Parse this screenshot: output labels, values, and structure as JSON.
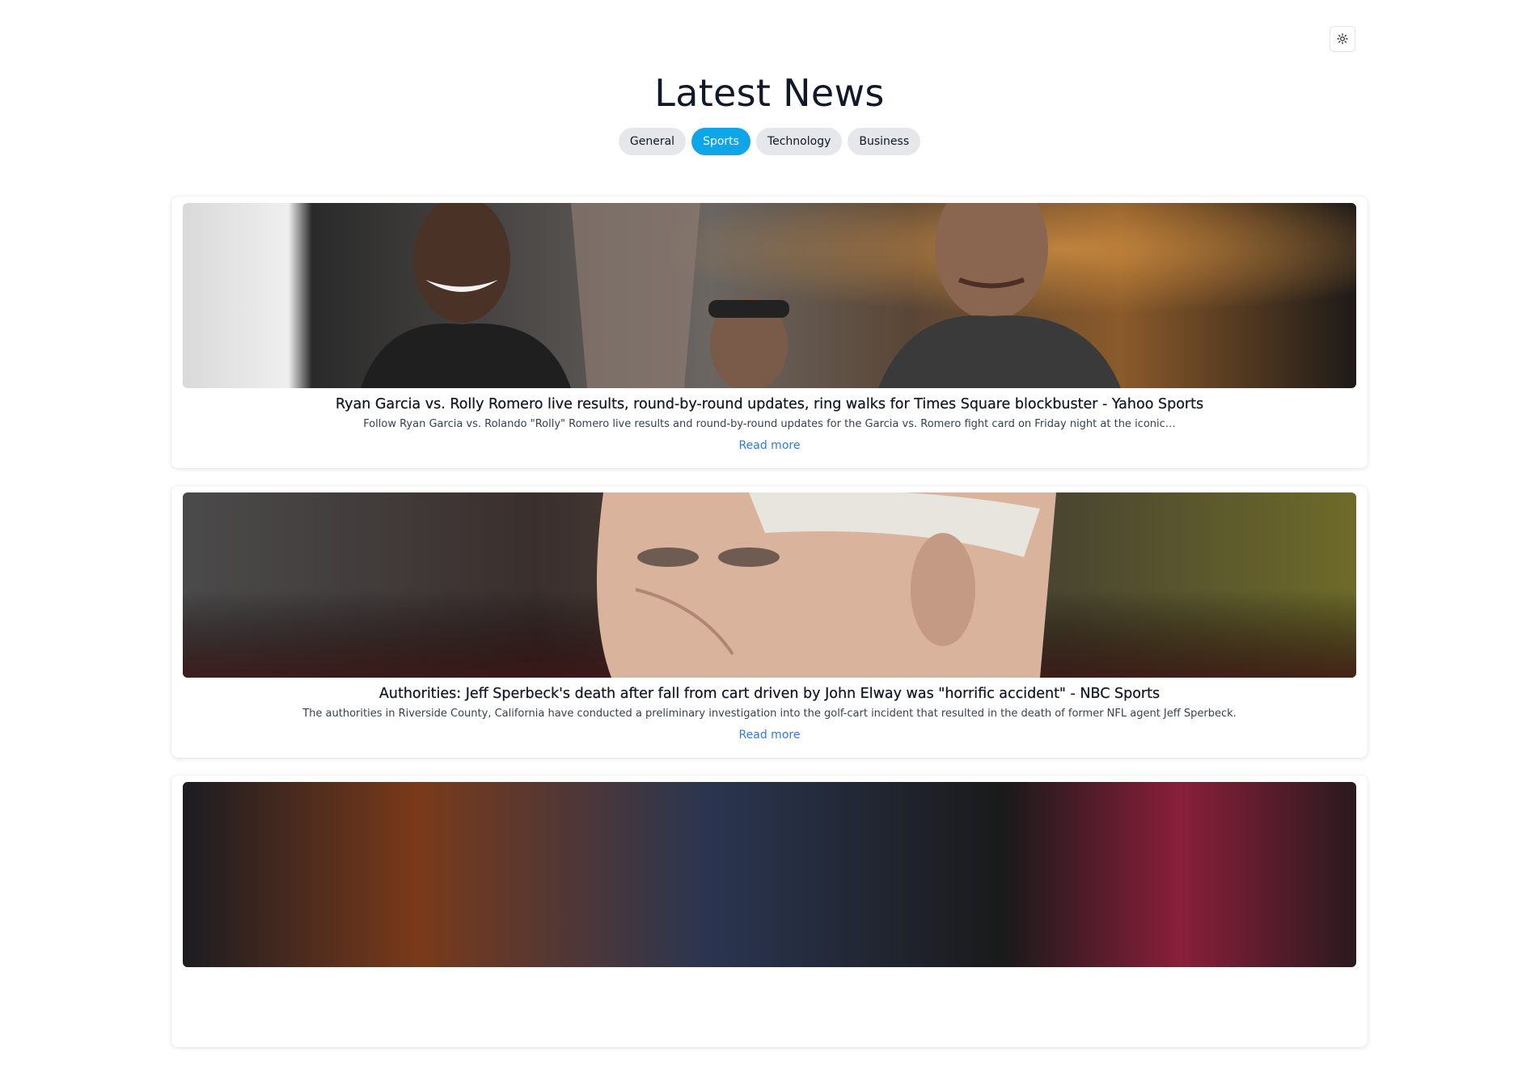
{
  "header": {
    "title": "Latest News",
    "theme_toggle_icon": "sun-icon"
  },
  "tabs": [
    {
      "label": "General",
      "active": false
    },
    {
      "label": "Sports",
      "active": true
    },
    {
      "label": "Technology",
      "active": false
    },
    {
      "label": "Business",
      "active": false
    }
  ],
  "articles": [
    {
      "title": "Ryan Garcia vs. Rolly Romero live results, round-by-round updates, ring walks for Times Square blockbuster - Yahoo Sports",
      "description": "Follow Ryan Garcia vs. Rolando \"Rolly\" Romero live results and round-by-round updates for the Garcia vs. Romero fight card on Friday night at the iconic…",
      "link_label": "Read more"
    },
    {
      "title": "Authorities: Jeff Sperbeck's death after fall from cart driven by John Elway was \"horrific accident\" - NBC Sports",
      "description": "The authorities in Riverside County, California have conducted a preliminary investigation into the golf-cart incident that resulted in the death of former NFL agent Jeff Sperbeck.",
      "link_label": "Read more"
    }
  ],
  "colors": {
    "active_tab": "#0ea5e9",
    "inactive_tab": "#e5e7eb",
    "link": "#2f7bd9",
    "title_text": "#111827"
  }
}
